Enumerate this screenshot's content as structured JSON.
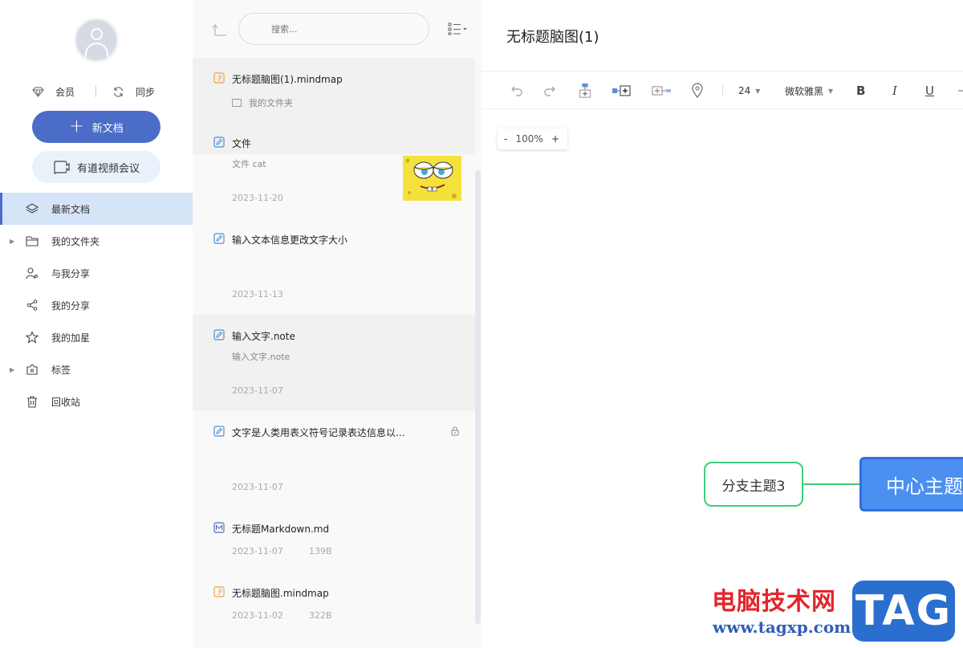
{
  "sidebar": {
    "vip_label": "会员",
    "sync_label": "同步",
    "new_doc_label": "新文档",
    "meeting_label": "有道视频会议",
    "nav": [
      {
        "label": "最新文档",
        "icon": "layers-icon",
        "active": true
      },
      {
        "label": "我的文件夹",
        "icon": "folder-icon",
        "expandable": true
      },
      {
        "label": "与我分享",
        "icon": "shared-with-me-icon"
      },
      {
        "label": "我的分享",
        "icon": "share-icon"
      },
      {
        "label": "我的加星",
        "icon": "star-icon"
      },
      {
        "label": "标签",
        "icon": "tag-icon",
        "expandable": true
      },
      {
        "label": "回收站",
        "icon": "trash-icon"
      }
    ]
  },
  "list": {
    "search_placeholder": "搜索...",
    "docs": [
      {
        "title": "无标题脑图(1).mindmap",
        "sub": "我的文件夹",
        "type": "mindmap",
        "highlight": true
      },
      {
        "title": "文件",
        "sub": "文件 cat",
        "date": "2023-11-20",
        "type": "note",
        "thumbnail": "spongebob"
      },
      {
        "title": "输入文本信息更改文字大小",
        "date": "2023-11-13",
        "type": "note"
      },
      {
        "title": "输入文字.note",
        "sub": "输入文字.note",
        "date": "2023-11-07",
        "type": "note",
        "highlight": true
      },
      {
        "title": "文字是人类用表义符号记录表达信息以...",
        "date": "2023-11-07",
        "type": "note",
        "locked": true
      },
      {
        "title": "无标题Markdown.md",
        "date": "2023-11-07",
        "size": "139B",
        "type": "markdown"
      },
      {
        "title": "无标题脑图.mindmap",
        "date": "2023-11-02",
        "size": "322B",
        "type": "mindmap"
      }
    ]
  },
  "editor": {
    "title": "无标题脑图(1)",
    "font_size": "24",
    "font_family": "微软雅黑",
    "bold": "B",
    "italic": "I",
    "underline": "U",
    "zoom_minus": "-",
    "zoom_level": "100%",
    "zoom_plus": "+",
    "branch_topic": "分支主题3",
    "center_topic": "中心主题",
    "branch_color": "#3fce7a",
    "center_color": "#4b8ff0"
  },
  "watermark": {
    "site_name": "电脑技术网",
    "url": "www.tagxp.com",
    "tag": "TAG"
  },
  "colors": {
    "accent": "#4b6dc8",
    "active_nav_bg": "#d6e4f8"
  }
}
